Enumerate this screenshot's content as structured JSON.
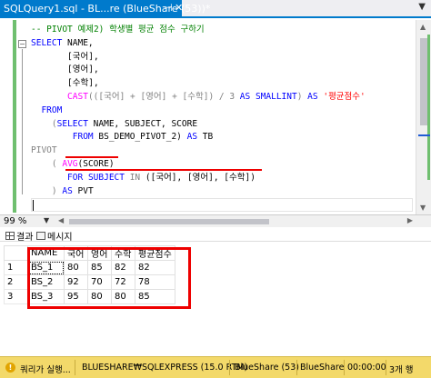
{
  "tab": {
    "title": "SQLQuery1.sql - BL...re (BlueShare (53))*",
    "pin_icon": "pin-icon",
    "close_icon": "close-icon"
  },
  "code": {
    "line1": "-- PIVOT 예제2) 학생별 평균 점수 구하기",
    "line2_kw": "SELECT",
    "line2_rest": " NAME,",
    "line3": "       [국어],",
    "line4": "       [영어],",
    "line5": "       [수학],",
    "line6_fn": "CAST",
    "line6_a": "(([국어] + [영어] + [수학]) / 3 ",
    "line6_as": "AS",
    "line6_type": " SMALLINT",
    "line6_b": ") ",
    "line6_as2": "AS",
    "line6_str": " '평균점수'",
    "line7_kw": "FROM",
    "line8_a": "(",
    "line8_kw": "SELECT",
    "line8_rest": " NAME, SUBJECT, SCORE",
    "line9_kw": "FROM",
    "line9_rest": " BS_DEMO_PIVOT_2) ",
    "line9_as": "AS",
    "line9_tb": " TB",
    "line10": "PIVOT",
    "line11_a": "( ",
    "line11_fn": "AVG",
    "line11_b": "(SCORE)",
    "line12_kw": "FOR",
    "line12_subj": " SUBJECT ",
    "line12_in": "IN",
    "line12_rest": " ([국어], [영어], [수학])",
    "line13_a": ") ",
    "line13_as": "AS",
    "line13_pvt": " PVT"
  },
  "zoom": "99 %",
  "result_tabs": {
    "results_label": "결과",
    "messages_label": "메시지"
  },
  "grid": {
    "columns": [
      "NAME",
      "국어",
      "영어",
      "수학",
      "평균점수"
    ],
    "rows": [
      {
        "rn": "1",
        "cells": [
          "BS_1",
          "80",
          "85",
          "82",
          "82"
        ]
      },
      {
        "rn": "2",
        "cells": [
          "BS_2",
          "92",
          "70",
          "72",
          "78"
        ]
      },
      {
        "rn": "3",
        "cells": [
          "BS_3",
          "95",
          "80",
          "80",
          "85"
        ]
      }
    ]
  },
  "status": {
    "query_status": "쿼리가 실행...",
    "server": "BLUESHARE₩SQLEXPRESS (15.0 RTM)",
    "user": "BlueShare (53)",
    "database": "BlueShare",
    "time": "00:00:00",
    "rows": "3개 행"
  },
  "colors": {
    "accent": "#007acc",
    "status_bar": "#f3d96a",
    "annotation": "#e00000"
  }
}
